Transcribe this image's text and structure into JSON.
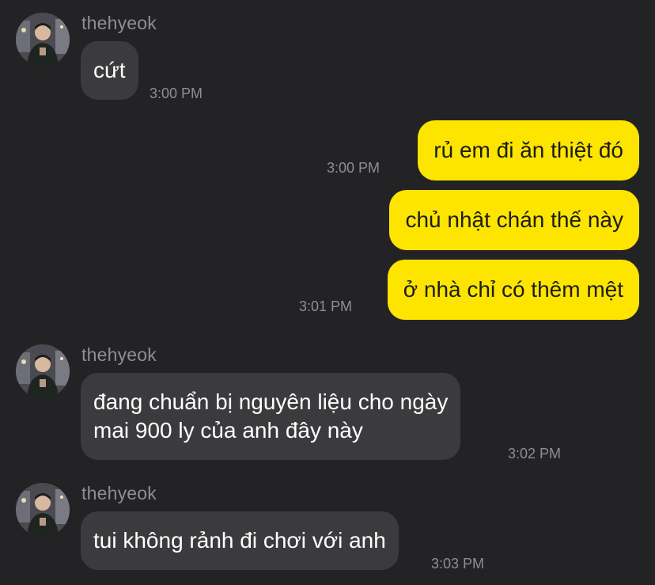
{
  "colors": {
    "background": "#232325",
    "incoming_bubble": "#3b3b3e",
    "outgoing_bubble": "#fde500",
    "meta_text": "#8e8e93"
  },
  "messages": [
    {
      "direction": "incoming",
      "sender": "thehyeok",
      "lines": [
        "cứt"
      ],
      "time": "3:00 PM"
    },
    {
      "direction": "outgoing",
      "lines": [
        "rủ em đi ăn thiệt đó"
      ],
      "time": "3:00 PM"
    },
    {
      "direction": "outgoing",
      "lines": [
        "chủ nhật chán thế này"
      ]
    },
    {
      "direction": "outgoing",
      "lines": [
        "ở nhà chỉ có thêm mệt"
      ],
      "time": "3:01 PM"
    },
    {
      "direction": "incoming",
      "sender": "thehyeok",
      "lines": [
        "đang chuẩn bị nguyên liệu cho ngày",
        "mai 900 ly của anh đây này"
      ],
      "time": "3:02 PM"
    },
    {
      "direction": "incoming",
      "sender": "thehyeok",
      "lines": [
        "tui không rảnh đi chơi với anh"
      ],
      "time": "3:03 PM"
    }
  ]
}
